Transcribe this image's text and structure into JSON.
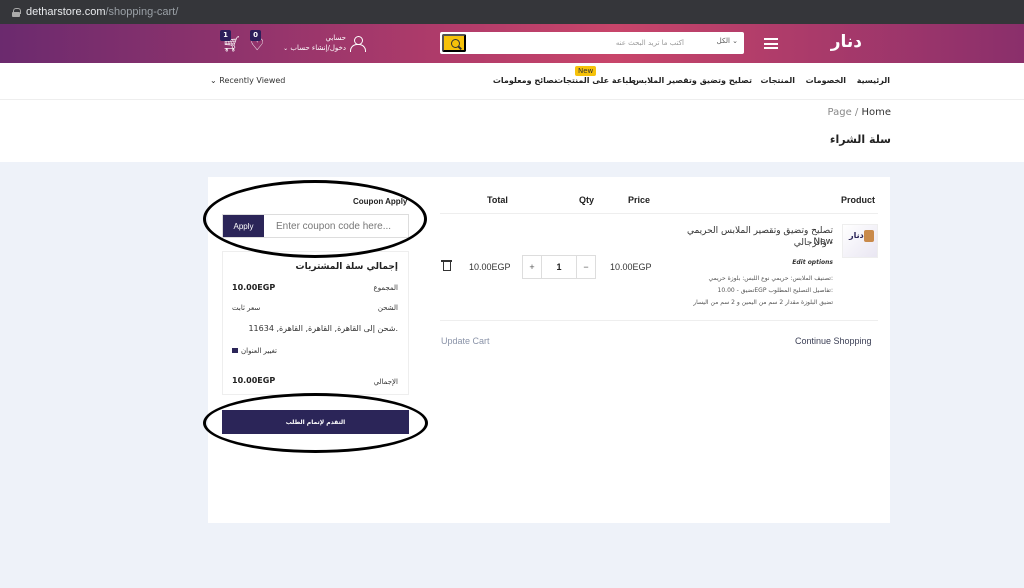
{
  "browser": {
    "domain": "detharstore.com",
    "path": "/shopping-cart/"
  },
  "header": {
    "logo": "دنار",
    "search_placeholder": "أكتب ما تريد البحث عنه",
    "search_category": "الكل",
    "user_greeting": "حسابي",
    "user_action": "دخول/إنشاء حساب",
    "wishlist_count": "0",
    "cart_count": "1"
  },
  "nav": {
    "items": [
      "الرئيسية",
      "الخصومات",
      "المنتجات",
      "تصليح وتضيق وتقصير الملابس",
      "طباعة على المنتجات",
      "نصائح ومعلومات"
    ],
    "new_badge": "New",
    "recently_viewed": "Recently Viewed"
  },
  "breadcrumb": {
    "home": "Home",
    "current": "Page"
  },
  "page_title": "سلة الشراء",
  "coupon": {
    "title": "Coupon Apply",
    "placeholder": "Enter coupon code here...",
    "apply_label": "Apply"
  },
  "summary": {
    "title": "إجمالي سلة المشتريات",
    "subtotal_label": "المجموع",
    "subtotal_value": "10.00EGP",
    "shipping_label": "الشحن",
    "shipping_value": "سعر ثابت",
    "ship_to": "شحن إلى القاهرة, القاهرة, القاهرة, 11634.",
    "change_address": "تغيير العنوان",
    "total_label": "الإجمالي",
    "total_value": "10.00EGP",
    "checkout_label": "التقدم لإتمام الطلب"
  },
  "table": {
    "headers": {
      "product": "Product",
      "price": "Price",
      "qty": "Qty",
      "total": "Total"
    },
    "item": {
      "name_line1": "تصليح وتضيق وتقصير الملابس الحريمي والرجالي -",
      "name_line2": "New",
      "edit_options": "Edit options",
      "options": [
        "تصنيف الملابس: حريمي نوع اللبس: بلوزة حريمي:",
        "تضيق - 10.00EGP تفاصيل التصليح المطلوب:",
        "تضيق البلوزة مقدار 2 سم من اليمين و 2 سم من اليسار"
      ],
      "price": "10.00EGP",
      "qty": "1",
      "total": "10.00EGP"
    },
    "update_cart": "Update Cart",
    "continue_shopping": "Continue Shopping"
  }
}
